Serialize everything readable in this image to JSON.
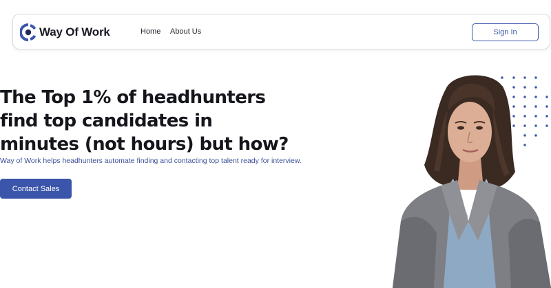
{
  "brand": {
    "name": "Way Of Work",
    "accent": "#3b55aa"
  },
  "nav": {
    "links": [
      {
        "label": "Home"
      },
      {
        "label": "About Us"
      }
    ],
    "signin_label": "Sign In"
  },
  "hero": {
    "headline_lines": [
      "The Top 1% of headhunters",
      "find top candidates in",
      "minutes (not hours) but how?"
    ],
    "subtext": "Way of Work helps headhunters automate finding and contacting top talent ready for interview.",
    "cta_label": "Contact Sales",
    "image": "professional-woman-portrait"
  },
  "icons": {
    "logo": "ring-logo-icon",
    "decoration": "dot-grid-pattern"
  }
}
